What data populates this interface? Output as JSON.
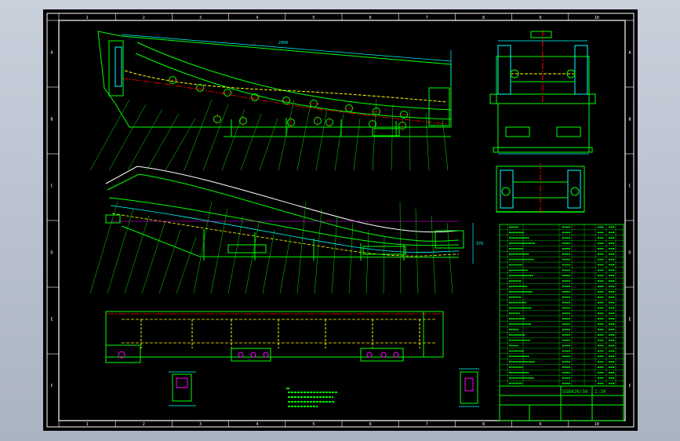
{
  "sheet": {
    "zone_cols": [
      "1",
      "2",
      "3",
      "4",
      "5",
      "6",
      "7",
      "8",
      "9",
      "10"
    ],
    "zone_rows": [
      "A",
      "B",
      "C",
      "D",
      "E",
      "F"
    ]
  },
  "colors": {
    "background": "#000000",
    "frame": "#ffffff",
    "geometry": "#00ff00",
    "dimension": "#00ffff",
    "hidden": "#ffff00",
    "centerline": "#ff0000",
    "hatch": "#ff00ff",
    "window": "#aab3c2"
  },
  "title_block": {
    "drawing_no": "SGB420/30",
    "scale": "1:20"
  }
}
